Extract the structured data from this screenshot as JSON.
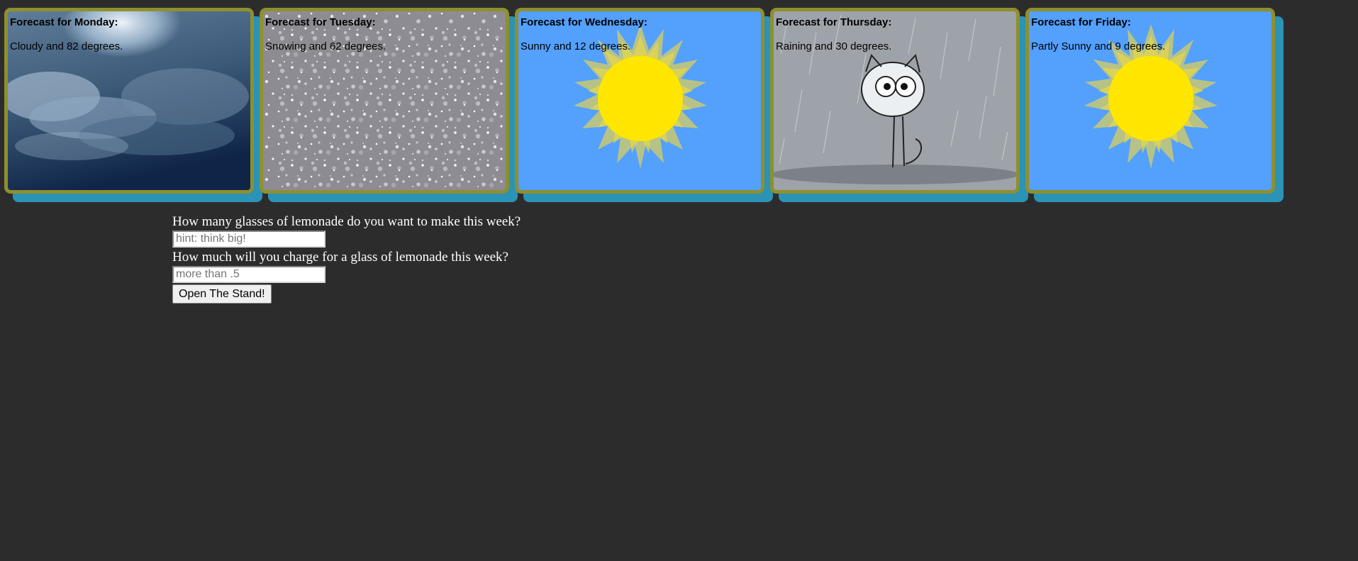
{
  "forecast": [
    {
      "title": "Forecast for Monday:",
      "description": "Cloudy and 82 degrees.",
      "weather_icon": "cloudy-sky-image"
    },
    {
      "title": "Forecast for Tuesday:",
      "description": "Snowing and 62 degrees.",
      "weather_icon": "snow-image"
    },
    {
      "title": "Forecast for Wednesday:",
      "description": "Sunny and 12 degrees.",
      "weather_icon": "sun-image"
    },
    {
      "title": "Forecast for Thursday:",
      "description": "Raining and 30 degrees.",
      "weather_icon": "rain-cat-image"
    },
    {
      "title": "Forecast for Friday:",
      "description": "Partly Sunny and 9 degrees.",
      "weather_icon": "sun-image"
    }
  ],
  "form": {
    "glasses_question": "How many glasses of lemonade do you want to make this week?",
    "glasses_placeholder": "hint: think big!",
    "glasses_value": "",
    "price_question": "How much will you charge for a glass of lemonade this week?",
    "price_placeholder": "more than .5",
    "price_value": "",
    "submit_label": "Open The Stand!"
  },
  "colors": {
    "page_background": "#2d2c2c",
    "card_border": "#8f8f2e",
    "card_shadow": "#2a93b6",
    "sky_blue": "#53a0fd",
    "sun_yellow": "#ffe600"
  }
}
